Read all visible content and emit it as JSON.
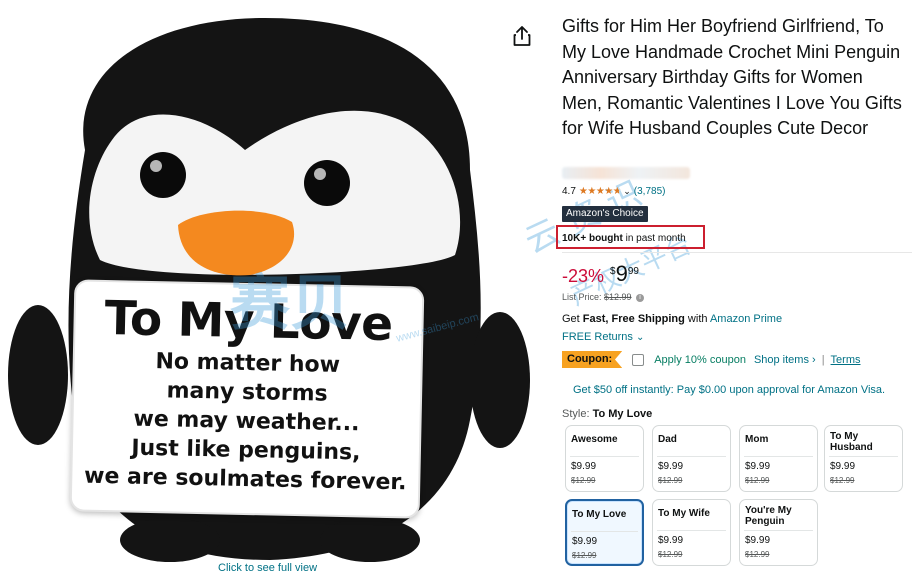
{
  "image": {
    "card_title": "To My Love",
    "card_lines": [
      "No matter how",
      "many storms",
      "we may weather...",
      "Just like penguins,",
      "we are soulmates forever."
    ],
    "caption": "Click to see full view",
    "watermark_main": "赛贝",
    "watermark_url": "www.saibeip.com",
    "watermark_side": "云 资 识",
    "watermark_side2": "产权大平台"
  },
  "product": {
    "title": "Gifts for Him Her Boyfriend Girlfriend, To My Love Handmade Crochet Mini Penguin Anniversary Birthday Gifts for Women Men, Romantic Valentines I Love You Gifts for Wife Husband Couples Cute Decor",
    "rating": "4.7",
    "rating_count": "(3,785)",
    "badge": "Amazon's Choice",
    "bought_bold": "10K+ bought",
    "bought_rest": " in past month",
    "discount": "-23%",
    "currency": "$",
    "price_whole": "9",
    "price_fraction": "99",
    "list_price_label": "List Price: ",
    "list_price": "$12.99",
    "shipping_prefix": "Get ",
    "shipping_bold": "Fast, Free Shipping",
    "shipping_mid": " with ",
    "shipping_link": "Amazon Prime",
    "returns": "FREE Returns",
    "coupon_label": "Coupon:",
    "coupon_apply": "Apply 10% coupon",
    "coupon_shop": "Shop items ›",
    "coupon_sep": "|",
    "coupon_terms": "Terms",
    "visa_offer": "Get $50 off instantly: Pay $0.00 upon approval for Amazon Visa.",
    "style_label": "Style: ",
    "style_value": "To My Love"
  },
  "variants": [
    {
      "name": "Awesome",
      "price": "$9.99",
      "list": "$12.99"
    },
    {
      "name": "Dad",
      "price": "$9.99",
      "list": "$12.99"
    },
    {
      "name": "Mom",
      "price": "$9.99",
      "list": "$12.99"
    },
    {
      "name": "To My Husband",
      "price": "$9.99",
      "list": "$12.99"
    },
    {
      "name": "To My Love",
      "price": "$9.99",
      "list": "$12.99"
    },
    {
      "name": "To My Wife",
      "price": "$9.99",
      "list": "$12.99"
    },
    {
      "name": "You're My Penguin",
      "price": "$9.99",
      "list": "$12.99"
    }
  ],
  "icons": {
    "share": "share-icon",
    "info": "info-icon",
    "chevron": "chevron-down-icon"
  },
  "colors": {
    "link": "#007185",
    "discount": "#cc0c39",
    "star": "#de7921",
    "coupon": "#f7a221",
    "badge": "#232f3e",
    "highlight_box": "#cc1f2f",
    "selected_border": "#2162a1"
  }
}
